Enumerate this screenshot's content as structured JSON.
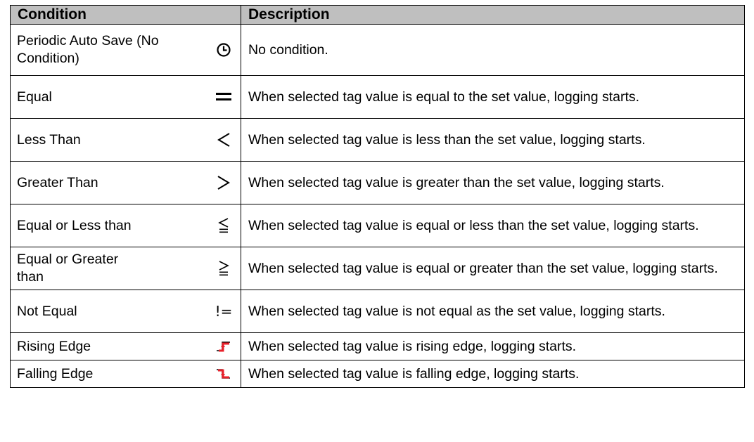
{
  "headers": {
    "condition": "Condition",
    "description": "Description"
  },
  "rows": [
    {
      "condition": "Periodic Auto Save (No Condition)",
      "icon": "clock-icon",
      "description": "No condition."
    },
    {
      "condition": "Equal",
      "icon": "equal-icon",
      "symbol": "═",
      "description": "When selected tag value is equal to the set value, logging starts."
    },
    {
      "condition": "Less Than",
      "icon": "less-than-icon",
      "symbol": "<",
      "description": "When selected tag value is less than the set value, logging starts."
    },
    {
      "condition": "Greater Than",
      "icon": "greater-than-icon",
      "symbol": ">",
      "description": "When selected tag value is greater than the set value, logging starts."
    },
    {
      "condition": "Equal or Less than",
      "icon": "less-or-equal-icon",
      "symbol": "≦",
      "description": "When selected tag value is equal or less than the set value, logging starts."
    },
    {
      "condition": "Equal or Greater than",
      "icon": "greater-or-equal-icon",
      "symbol": "≧",
      "description": "When selected tag value is equal or greater than the set value, logging starts."
    },
    {
      "condition": "Not Equal",
      "icon": "not-equal-icon",
      "symbol": "!=",
      "description": "When selected tag value is not equal as the set value, logging starts."
    },
    {
      "condition": "Rising Edge",
      "icon": "rising-edge-icon",
      "description": "When selected tag value is rising edge, logging starts."
    },
    {
      "condition": "Falling Edge",
      "icon": "falling-edge-icon",
      "description": "When selected tag value is falling edge, logging starts."
    }
  ],
  "colors": {
    "header_bg": "#bfbfbf",
    "edge_icon": "#e8202a",
    "border": "#000000"
  }
}
